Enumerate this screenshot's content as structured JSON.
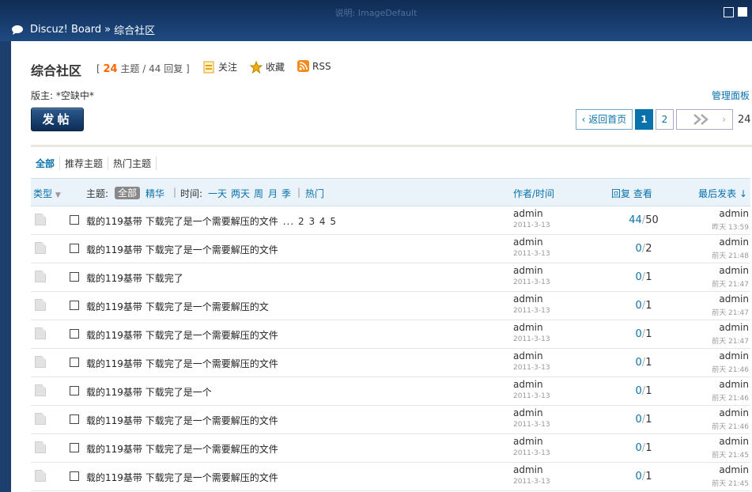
{
  "watermark": "说明: ImageDefault",
  "breadcrumb": {
    "site": "Discuz! Board",
    "sep": "»",
    "forum": "综合社区"
  },
  "forum": {
    "title": "综合社区",
    "threads": "24",
    "threads_label": "主题",
    "replies": "44",
    "replies_label": "回复",
    "follow": "关注",
    "favorite": "收藏",
    "rss": "RSS",
    "moderator": "版主: *空缺中*",
    "admin_panel": "管理面板",
    "post_button": "发帖"
  },
  "pager": {
    "back": "返回首页",
    "pages": [
      "1",
      "2"
    ],
    "current": "1",
    "total": "24"
  },
  "tabs": [
    "全部",
    "推荐主题",
    "热门主题"
  ],
  "header": {
    "type": "类型",
    "topic_label": "主题:",
    "all": "全部",
    "digest": "精华",
    "time_label": "时间:",
    "time_filters": [
      "一天",
      "两天",
      "周",
      "月",
      "季"
    ],
    "hot": "热门",
    "author": "作者/时间",
    "replies_views": "回复 查看",
    "last_post": "最后发表"
  },
  "threads": [
    {
      "title": "载的119基带 下载完了是一个需要解压的文件",
      "pages": "... 2  3  4  5",
      "author": "admin",
      "date": "2011-3-13",
      "replies": "44",
      "views": "50",
      "last_author": "admin",
      "last_time": "昨天 13:59"
    },
    {
      "title": "载的119基带 下载完了是一个需要解压的文件",
      "pages": "",
      "author": "admin",
      "date": "2011-3-13",
      "replies": "0",
      "views": "2",
      "last_author": "admin",
      "last_time": "前天 21:48"
    },
    {
      "title": "载的119基带 下载完了",
      "pages": "",
      "author": "admin",
      "date": "2011-3-13",
      "replies": "0",
      "views": "1",
      "last_author": "admin",
      "last_time": "前天 21:47"
    },
    {
      "title": "载的119基带 下载完了是一个需要解压的文",
      "pages": "",
      "author": "admin",
      "date": "2011-3-13",
      "replies": "0",
      "views": "1",
      "last_author": "admin",
      "last_time": "前天 21:47"
    },
    {
      "title": "载的119基带 下载完了是一个需要解压的文件",
      "pages": "",
      "author": "admin",
      "date": "2011-3-13",
      "replies": "0",
      "views": "1",
      "last_author": "admin",
      "last_time": "前天 21:47"
    },
    {
      "title": "载的119基带 下载完了是一个需要解压的文件",
      "pages": "",
      "author": "admin",
      "date": "2011-3-13",
      "replies": "0",
      "views": "1",
      "last_author": "admin",
      "last_time": "前天 21:46"
    },
    {
      "title": "载的119基带 下载完了是一个",
      "pages": "",
      "author": "admin",
      "date": "2011-3-13",
      "replies": "0",
      "views": "1",
      "last_author": "admin",
      "last_time": "前天 21:46"
    },
    {
      "title": "载的119基带 下载完了是一个需要解压的文件",
      "pages": "",
      "author": "admin",
      "date": "2011-3-13",
      "replies": "0",
      "views": "1",
      "last_author": "admin",
      "last_time": "前天 21:46"
    },
    {
      "title": "载的119基带 下载完了是一个需要解压的文件",
      "pages": "",
      "author": "admin",
      "date": "2011-3-13",
      "replies": "0",
      "views": "1",
      "last_author": "admin",
      "last_time": "前天 21:45"
    },
    {
      "title": "载的119基带 下载完了是一个需要解压的文件",
      "pages": "",
      "author": "admin",
      "date": "2011-3-13",
      "replies": "0",
      "views": "1",
      "last_author": "admin",
      "last_time": "前天 21:45"
    }
  ]
}
